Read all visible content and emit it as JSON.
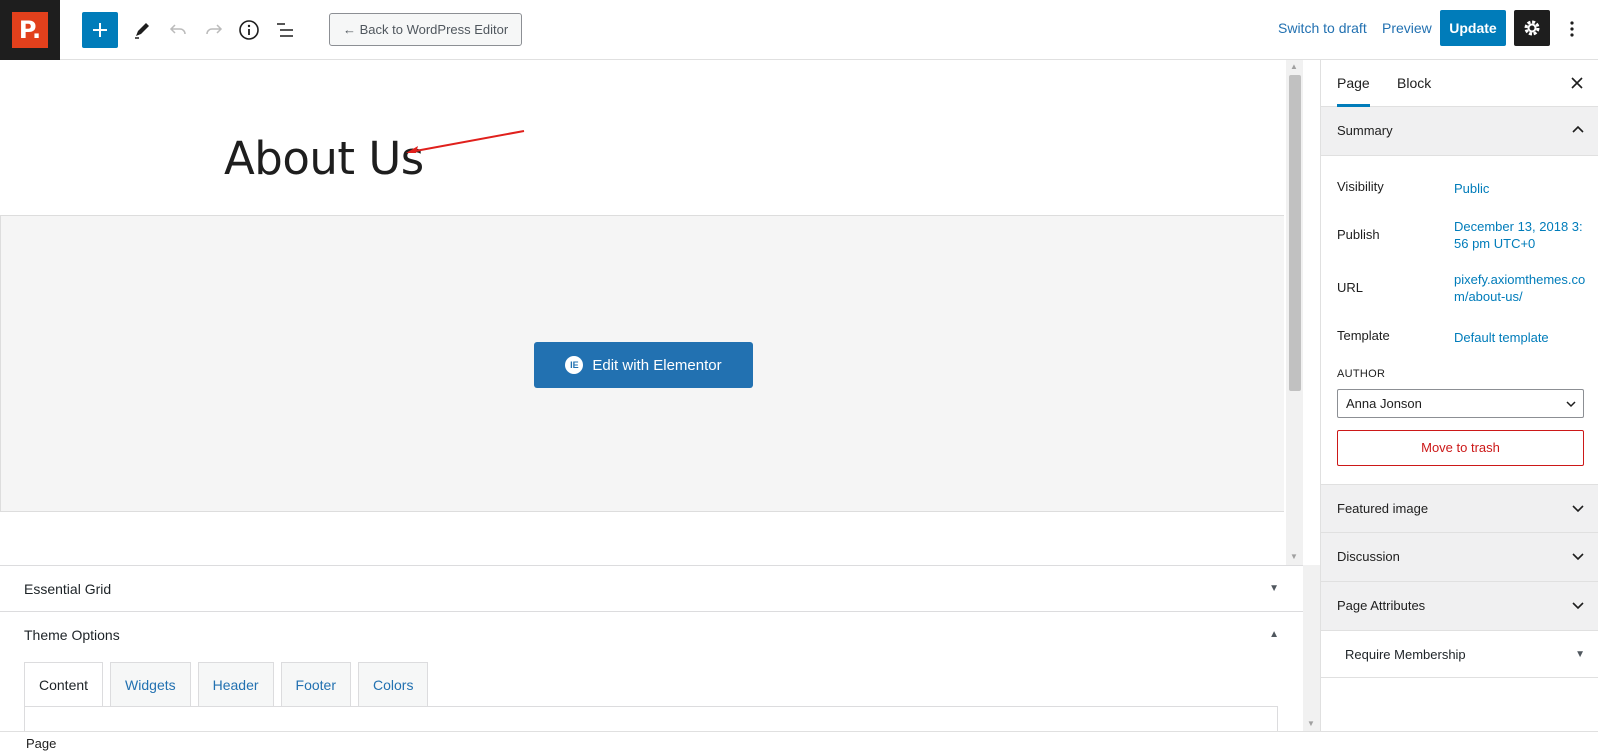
{
  "topbar": {
    "logo_letter": "P.",
    "back_label": "← Back to WordPress Editor",
    "switch_draft_label": "Switch to draft",
    "preview_label": "Preview",
    "update_label": "Update"
  },
  "editor": {
    "title": "About Us",
    "elementor_label": "Edit with Elementor",
    "elementor_icon_text": "IE"
  },
  "metaboxes": {
    "essential_grid": "Essential Grid",
    "theme_options": "Theme Options",
    "tabs": [
      "Content",
      "Widgets",
      "Header",
      "Footer",
      "Colors"
    ]
  },
  "footer": {
    "breadcrumb": "Page"
  },
  "sidebar": {
    "tabs": [
      "Page",
      "Block"
    ],
    "summary_title": "Summary",
    "visibility_label": "Visibility",
    "visibility_value": "Public",
    "publish_label": "Publish",
    "publish_value": "December 13, 2018 3:56 pm UTC+0",
    "url_label": "URL",
    "url_value": "pixefy.axiomthemes.com/about-us/",
    "template_label": "Template",
    "template_value": "Default template",
    "author_label": "AUTHOR",
    "author_value": "Anna Jonson",
    "trash_label": "Move to trash",
    "featured_image": "Featured image",
    "discussion": "Discussion",
    "page_attributes": "Page Attributes",
    "require_membership": "Require Membership"
  },
  "colors": {
    "accent": "#007cba",
    "logo": "#e2401c",
    "danger": "#cc1818"
  }
}
